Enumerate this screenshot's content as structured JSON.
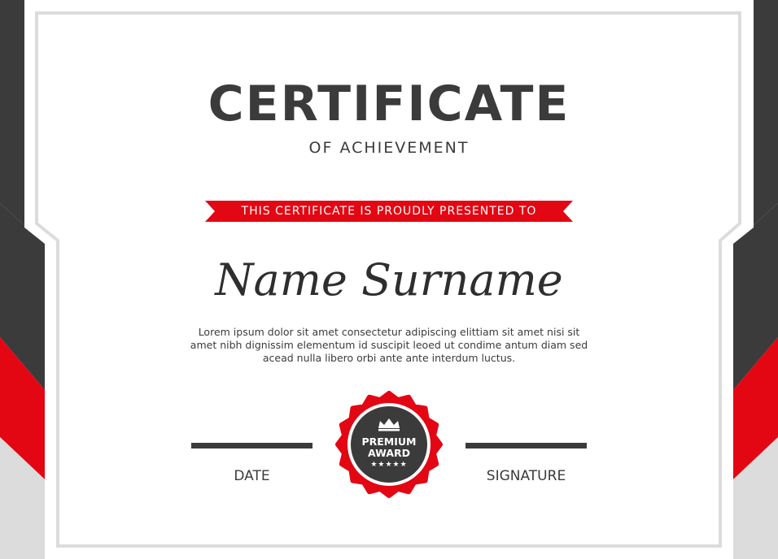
{
  "certificate": {
    "title": "CERTIFICATE",
    "subtitle": "OF ACHIEVEMENT",
    "presented_to": "THIS CERTIFICATE IS PROUDLY PRESENTED TO",
    "recipient_name": "Name Surname",
    "body_lines": [
      "Lorem ipsum dolor sit amet consectetur adipiscing elittiam sit amet nisi sit",
      "amet nibh dignissim elementum id suscipit leoed ut condime antum diam sed",
      "acead nulla libero orbi ante ante interdum luctus."
    ],
    "date_label": "DATE",
    "signature_label": "SIGNATURE"
  },
  "seal": {
    "line1": "PREMIUM",
    "line2": "AWARD",
    "stars": "★★★★★",
    "icon": "crown-icon"
  },
  "colors": {
    "accent_red": "#e30613",
    "dark_gray": "#3b3b3b",
    "light_gray": "#dcdcdc",
    "white": "#ffffff"
  }
}
